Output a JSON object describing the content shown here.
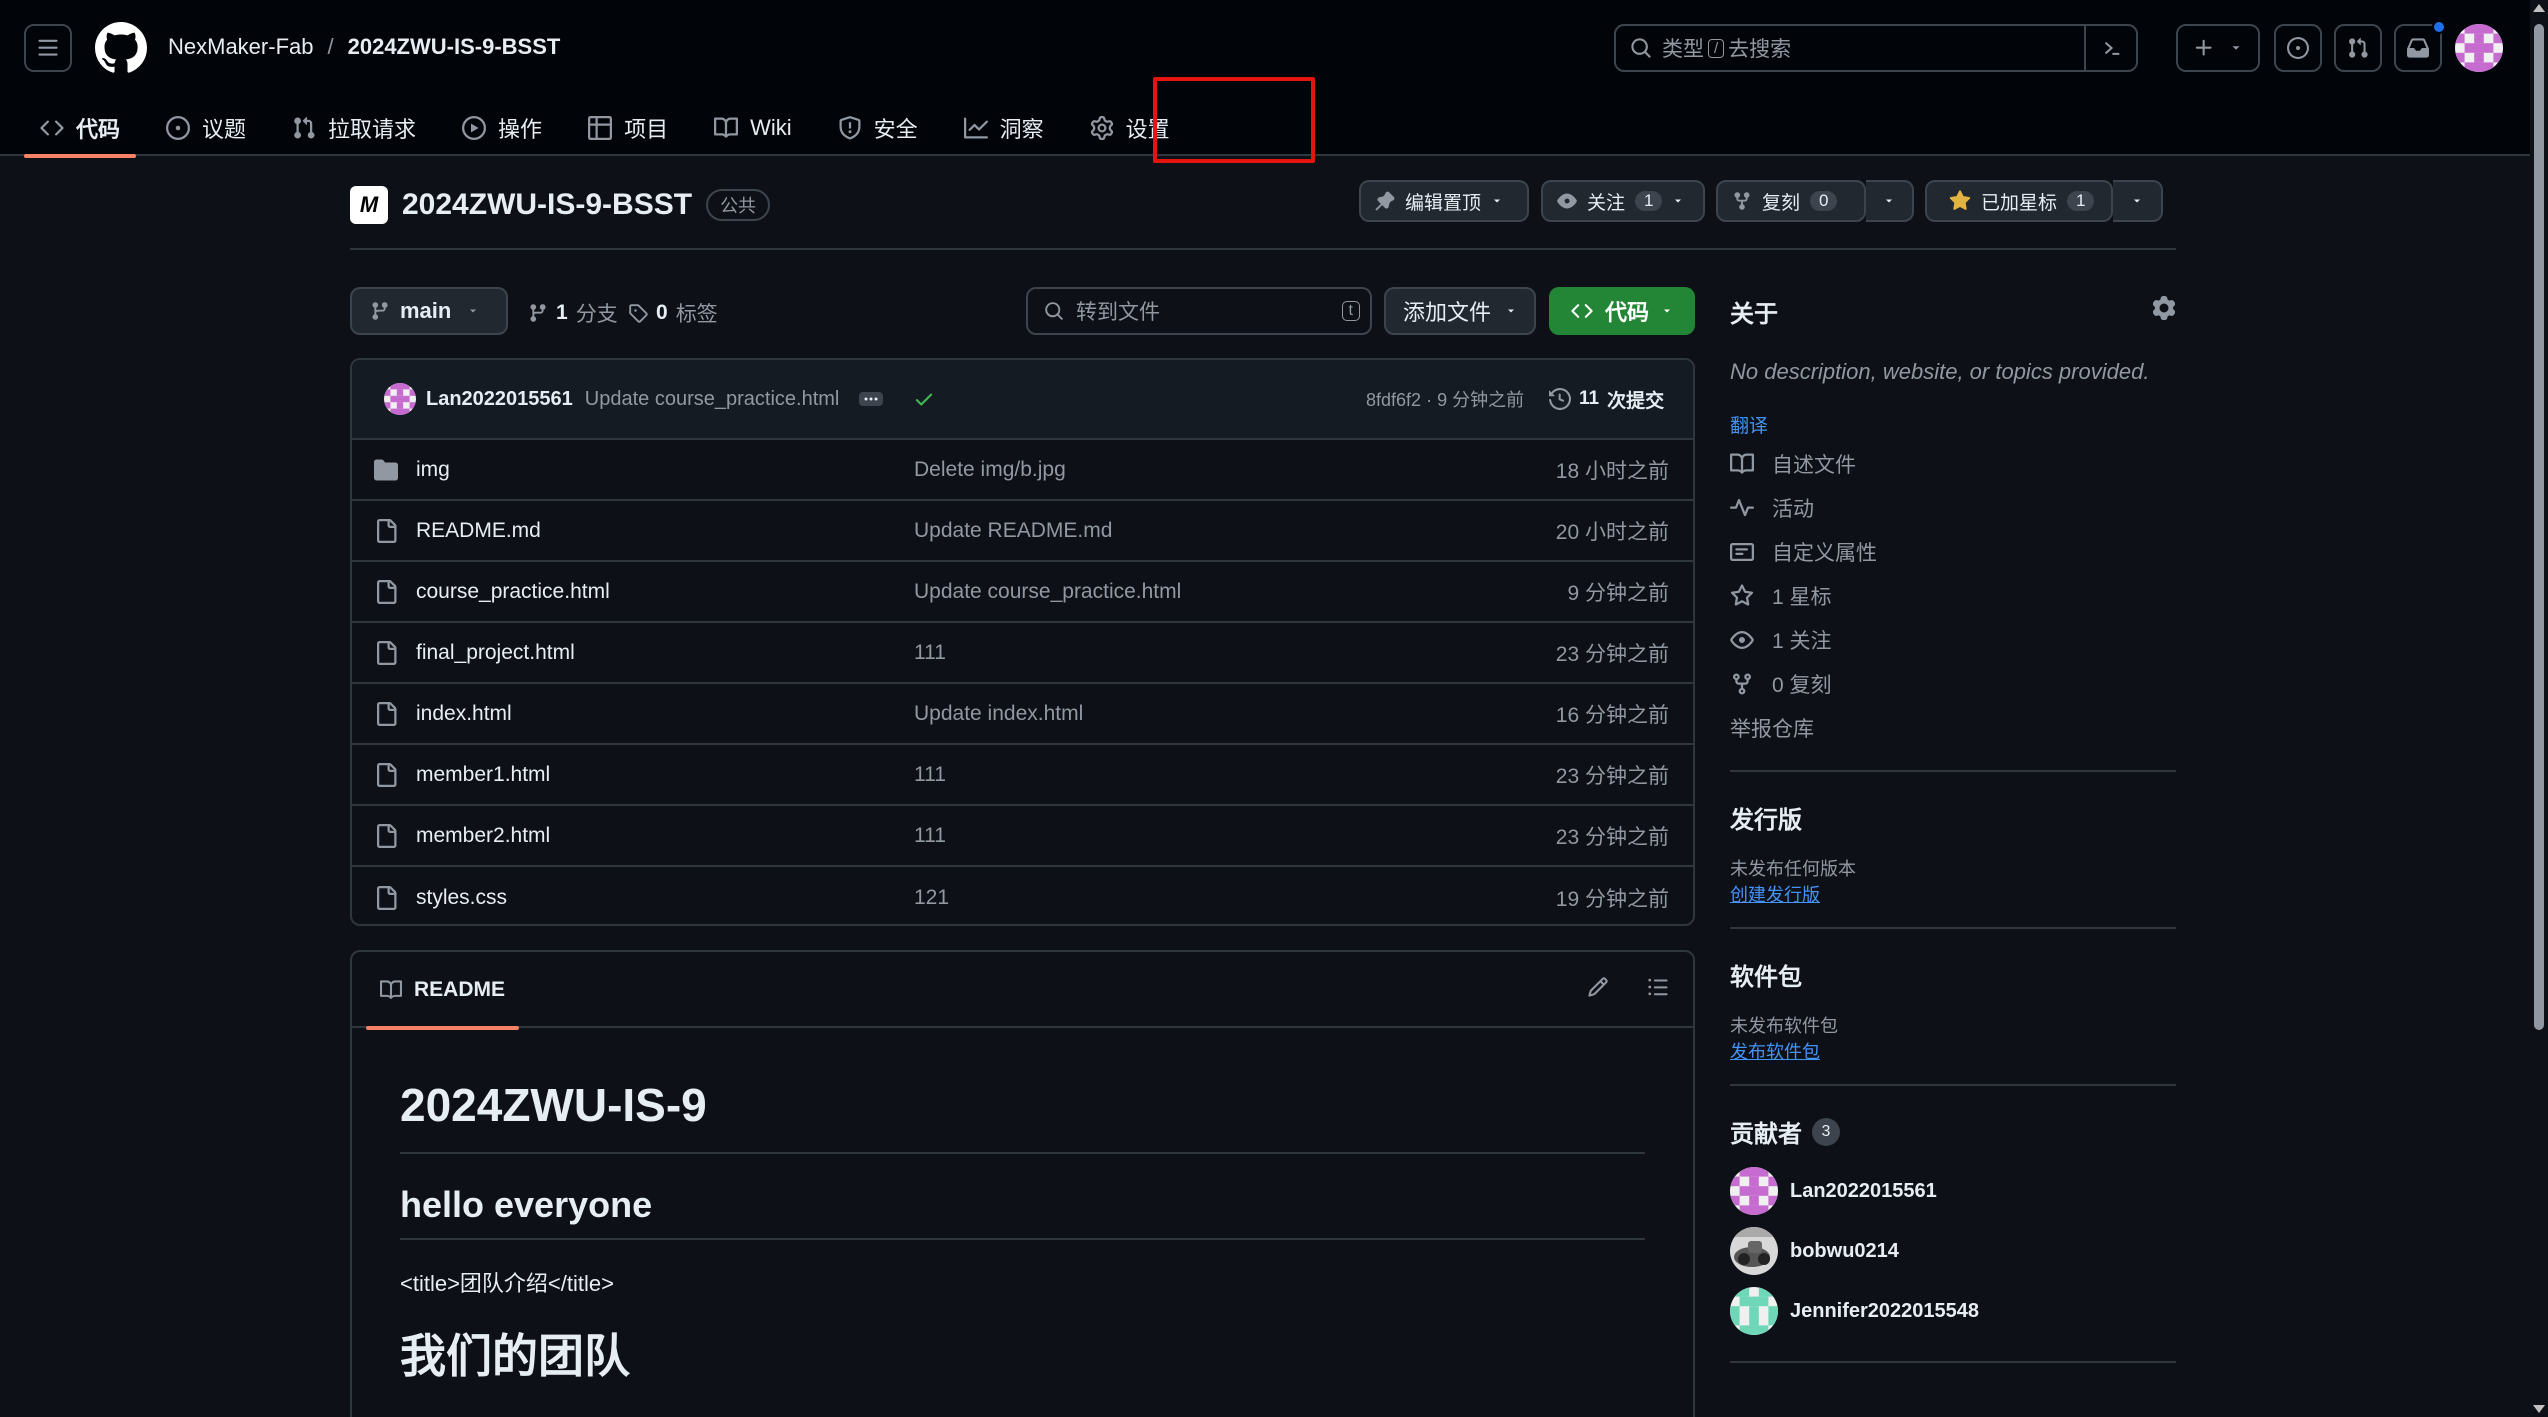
{
  "header": {
    "owner": "NexMaker-Fab",
    "separator": "/",
    "repo": "2024ZWU-IS-9-BSST",
    "search_placeholder_pre": "类型",
    "search_key": "/",
    "search_placeholder_post": "去搜索"
  },
  "nav": {
    "tabs": [
      {
        "label": "代码",
        "icon": "code-icon",
        "active": true
      },
      {
        "label": "议题",
        "icon": "issue-icon"
      },
      {
        "label": "拉取请求",
        "icon": "pull-request-icon"
      },
      {
        "label": "操作",
        "icon": "play-icon"
      },
      {
        "label": "项目",
        "icon": "table-icon"
      },
      {
        "label": "Wiki",
        "icon": "book-icon"
      },
      {
        "label": "安全",
        "icon": "shield-icon"
      },
      {
        "label": "洞察",
        "icon": "graph-icon"
      },
      {
        "label": "设置",
        "icon": "gear-icon"
      }
    ]
  },
  "repo": {
    "avatar_text": "M",
    "name": "2024ZWU-IS-9-BSST",
    "visibility": "公共",
    "pin_label": "编辑置顶",
    "watch_label": "关注",
    "watch_count": "1",
    "fork_label": "复刻",
    "fork_count": "0",
    "star_label": "已加星标",
    "star_count": "1"
  },
  "browser": {
    "branch": "main",
    "branches_count": "1",
    "branches_label": "分支",
    "tags_count": "0",
    "tags_label": "标签",
    "goto_placeholder": "转到文件",
    "goto_key": "t",
    "add_file_label": "添加文件",
    "code_label": "代码"
  },
  "commit": {
    "author": "Lan2022015561",
    "message": "Update course_practice.html",
    "hash": "8fdf6f2",
    "dot": "·",
    "time": "9 分钟之前",
    "commits_count": "11",
    "commits_label": "次提交"
  },
  "files": [
    {
      "name": "img",
      "type": "folder",
      "message": "Delete img/b.jpg",
      "date": "18 小时之前"
    },
    {
      "name": "README.md",
      "type": "file",
      "message": "Update README.md",
      "date": "20 小时之前"
    },
    {
      "name": "course_practice.html",
      "type": "file",
      "message": "Update course_practice.html",
      "date": "9 分钟之前"
    },
    {
      "name": "final_project.html",
      "type": "file",
      "message": "111",
      "date": "23 分钟之前"
    },
    {
      "name": "index.html",
      "type": "file",
      "message": "Update index.html",
      "date": "16 分钟之前"
    },
    {
      "name": "member1.html",
      "type": "file",
      "message": "111",
      "date": "23 分钟之前"
    },
    {
      "name": "member2.html",
      "type": "file",
      "message": "111",
      "date": "23 分钟之前"
    },
    {
      "name": "styles.css",
      "type": "file",
      "message": "121",
      "date": "19 分钟之前"
    }
  ],
  "readme": {
    "tab_label": "README",
    "h1": "2024ZWU-IS-9",
    "h2": "hello everyone",
    "p": "<title>团队介绍</title>",
    "h1b": "我们的团队"
  },
  "about": {
    "title": "关于",
    "description": "No description, website, or topics provided.",
    "translate": "翻译",
    "items": [
      {
        "label": "自述文件",
        "icon": "book-icon"
      },
      {
        "label": "活动",
        "icon": "pulse-icon"
      },
      {
        "label": "自定义属性",
        "icon": "note-icon"
      },
      {
        "label": "1 星标",
        "icon": "star-icon"
      },
      {
        "label": "1 关注",
        "icon": "eye-icon"
      },
      {
        "label": "0 复刻",
        "icon": "fork-icon"
      }
    ],
    "report": "举报仓库"
  },
  "releases": {
    "title": "发行版",
    "none": "未发布任何版本",
    "create": "创建发行版"
  },
  "packages": {
    "title": "软件包",
    "none": "未发布软件包",
    "publish": "发布软件包"
  },
  "contributors": {
    "title": "贡献者",
    "count": "3",
    "list": [
      {
        "name": "Lan2022015561"
      },
      {
        "name": "bobwu0214"
      },
      {
        "name": "Jennifer2022015548"
      }
    ]
  },
  "colors": {
    "background": "#0d1117",
    "header_bg": "#010409",
    "accent_tab": "#f78166",
    "code_button": "#238636",
    "link": "#4493f8",
    "highlight_box": "#e5140f"
  }
}
